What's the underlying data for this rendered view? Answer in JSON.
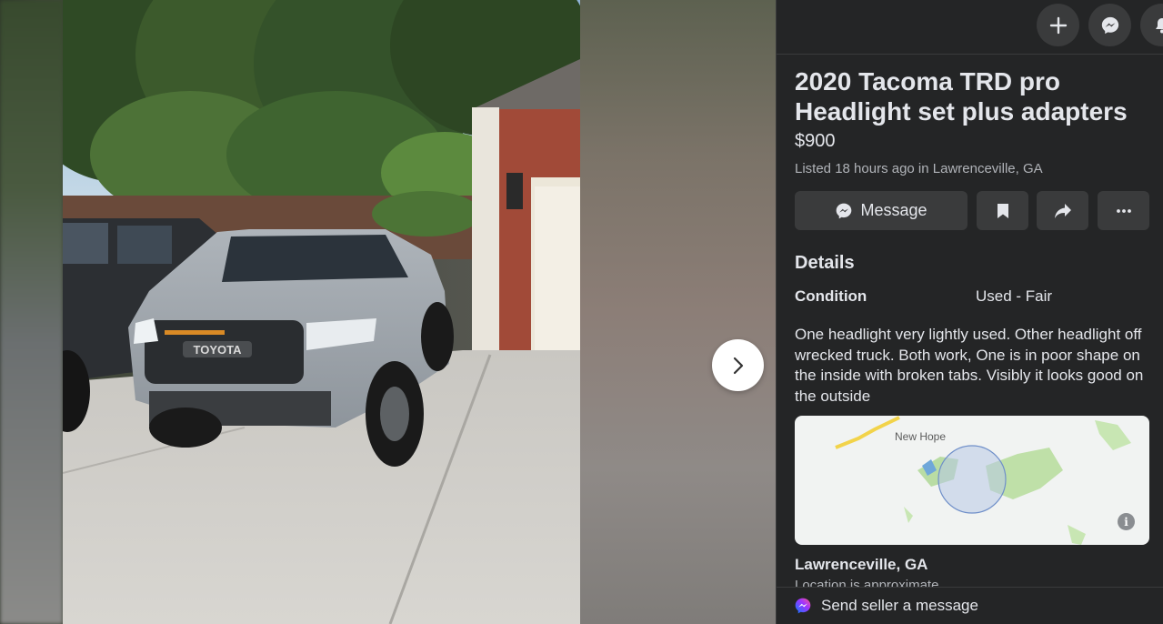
{
  "top_actions": [
    {
      "icon": "plus-icon",
      "label": "Create"
    },
    {
      "icon": "messenger-icon",
      "label": "Messenger"
    },
    {
      "icon": "bell-icon",
      "label": "Notifications"
    }
  ],
  "listing": {
    "title": "2020 Tacoma TRD pro Headlight set plus adapters",
    "price": "$900",
    "listed": "Listed 18 hours ago in Lawrenceville, GA",
    "photo_alt": "Gray Toyota Tacoma TRD Pro parked in driveway",
    "photo_badge": "TOYOTA"
  },
  "actions": {
    "message_label": "Message"
  },
  "details": {
    "heading": "Details",
    "condition_label": "Condition",
    "condition_value": "Used - Fair",
    "description": "One headlight very lightly used. Other headlight off wrecked truck. Both work, One is in poor shape on the inside with broken tabs. Visibly it looks good on the outside"
  },
  "map": {
    "place_label": "New Hope",
    "info_glyph": "i"
  },
  "location": {
    "name": "Lawrenceville, GA",
    "note": "Location is approximate"
  },
  "footer": {
    "send_label": "Send seller a message"
  },
  "colors": {
    "panel_bg": "#242526",
    "button_bg": "#3a3b3c",
    "text_primary": "#e4e6eb",
    "text_secondary": "#b0b3b8"
  }
}
